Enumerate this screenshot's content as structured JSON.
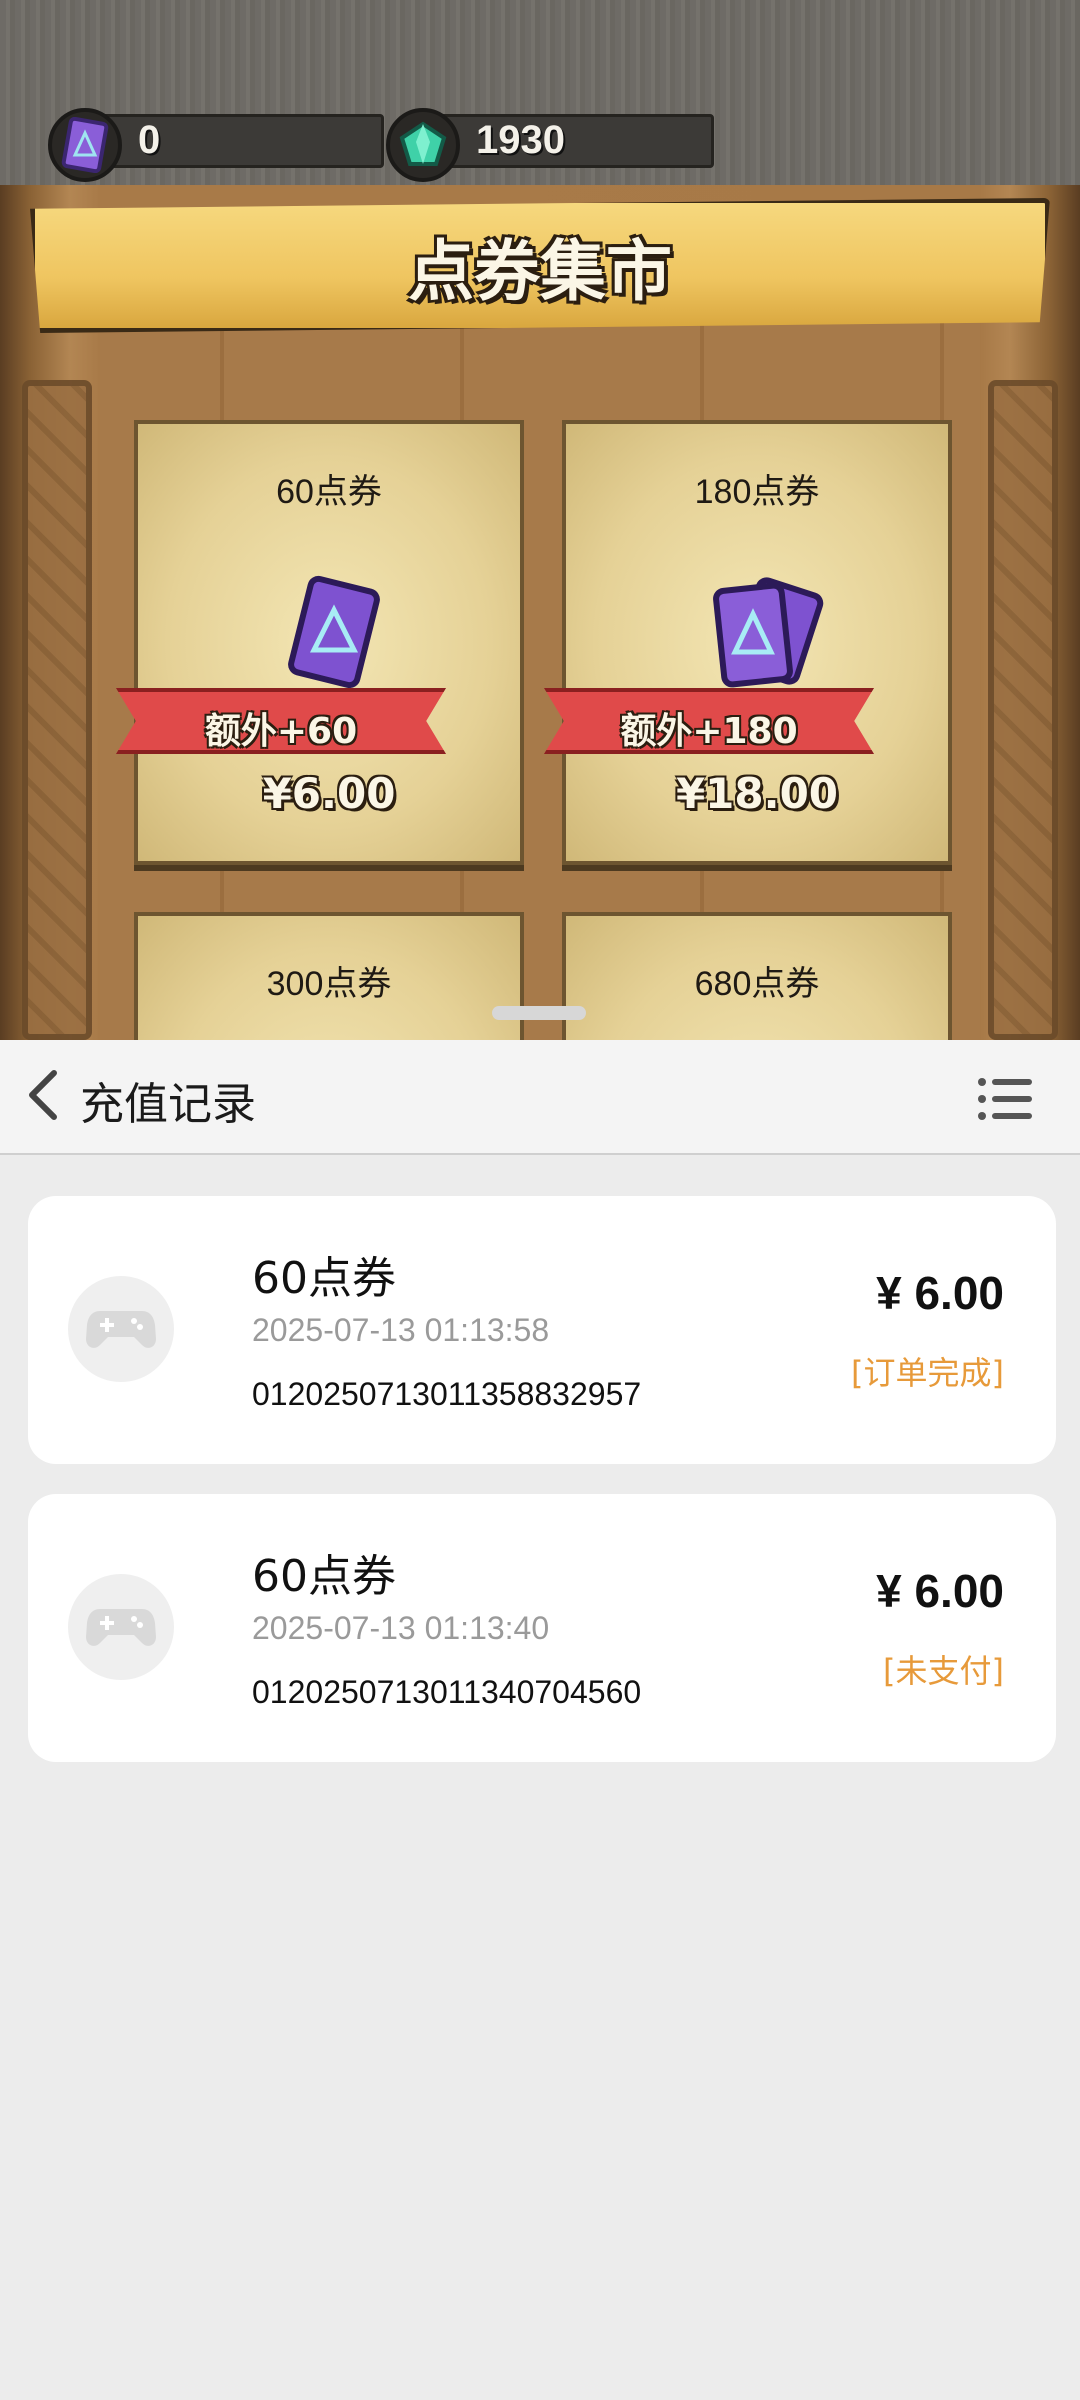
{
  "game": {
    "currency": [
      {
        "icon": "purple-card-icon",
        "value": "0"
      },
      {
        "icon": "green-gem-icon",
        "value": "1930"
      }
    ],
    "banner_title": "点券集市",
    "products": [
      {
        "name": "60点券",
        "bonus": "额外+60",
        "price": "¥6.00"
      },
      {
        "name": "180点券",
        "bonus": "额外+180",
        "price": "¥18.00"
      },
      {
        "name": "300点券"
      },
      {
        "name": "680点券"
      }
    ]
  },
  "sheet": {
    "title": "充值记录",
    "records": [
      {
        "item": "60点券",
        "time": "2025-07-13 01:13:58",
        "order_no": "012025071301135883​2957",
        "amount": "¥ 6.00",
        "status": "[订单完成]"
      },
      {
        "item": "60点券",
        "time": "2025-07-13 01:13:40",
        "order_no": "012025071301134070 4560",
        "amount": "¥ 6.00",
        "status": "[未支付]"
      }
    ]
  },
  "colors": {
    "status_orange": "#e79a3a",
    "ribbon_red": "#e04a4a",
    "banner_gold": "#efc560",
    "sheet_bg": "#ececec"
  }
}
